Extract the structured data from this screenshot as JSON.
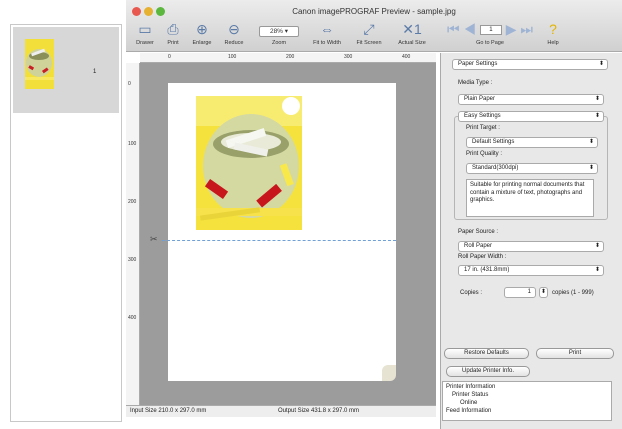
{
  "window": {
    "title": "Canon imagePROGRAF Preview - sample.jpg"
  },
  "thumbnail": {
    "page_number": "1"
  },
  "toolbar": {
    "drawer": "Drawer",
    "print": "Print",
    "enlarge": "Enlarge",
    "reduce": "Reduce",
    "zoom_label": "Zoom",
    "zoom_value": "28%",
    "fit_width": "Fit to Width",
    "fit_screen": "Fit Screen",
    "actual_size": "Actual Size",
    "page_value": "1",
    "go_to_page": "Go to Page",
    "help": "Help"
  },
  "ruler": {
    "ticks": [
      "0",
      "100",
      "200",
      "300",
      "400"
    ]
  },
  "status": {
    "input_size": "Input Size 210.0 x 297.0 mm",
    "output_size": "Output Size 431.8 x 297.0 mm"
  },
  "panel": {
    "section": "Paper Settings",
    "media_type_label": "Media Type :",
    "media_type_value": "Plain Paper",
    "easy_settings": "Easy Settings",
    "print_target_label": "Print Target :",
    "print_target_value": "Default Settings",
    "print_quality_label": "Print Quality :",
    "print_quality_value": "Standard(300dpi)",
    "quality_description": "Suitable for printing normal documents that contain a mixture of text, photographs and graphics.",
    "paper_source_label": "Paper Source :",
    "paper_source_value": "Roll Paper",
    "roll_width_label": "Roll Paper Width :",
    "roll_width_value": "17 in. (431.8mm)",
    "copies_label": "Copies :",
    "copies_value": "1",
    "copies_range": "copies (1 - 999)",
    "restore_defaults": "Restore Defaults",
    "print_button": "Print",
    "update_printer": "Update Printer Info.",
    "info_lines": [
      "Printer Information",
      "Printer Status",
      "Online",
      "Feed Information"
    ]
  },
  "colors": {
    "cut_line": "#6fa0d8",
    "canvas_bg": "#9c9c9c",
    "toolbar_icon": "#5a7aa8"
  }
}
